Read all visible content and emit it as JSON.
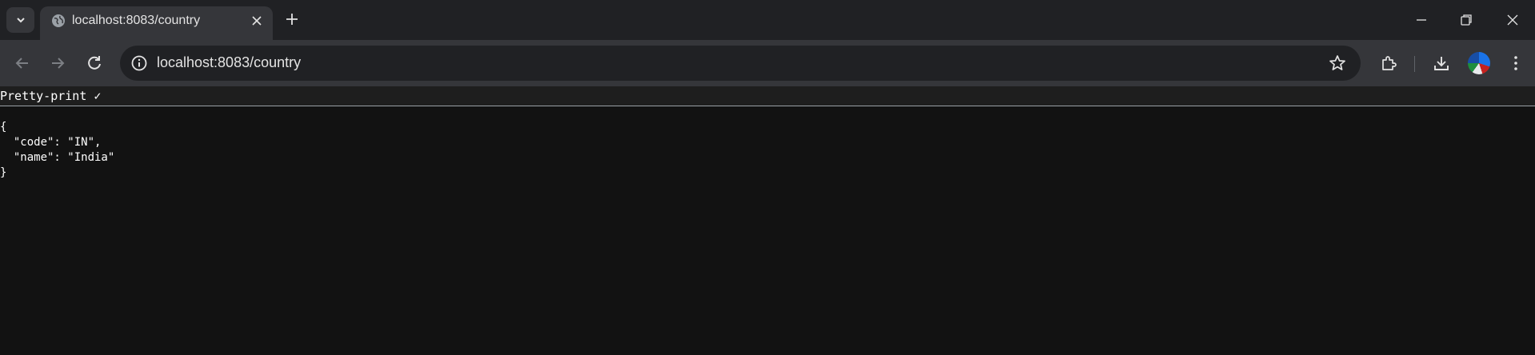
{
  "browser": {
    "tab": {
      "title": "localhost:8083/country",
      "favicon": "globe-icon"
    },
    "address_bar": {
      "url": "localhost:8083/country"
    },
    "icons": {
      "tab_search": "chevron-down-icon",
      "tab_close": "close-icon",
      "new_tab": "plus-icon",
      "minimize": "minimize-icon",
      "restore": "restore-icon",
      "close_window": "close-icon",
      "back": "back-arrow-icon",
      "forward": "forward-arrow-icon",
      "reload": "reload-icon",
      "site_info": "info-icon",
      "bookmark": "star-icon",
      "extensions": "puzzle-icon",
      "downloads": "download-icon",
      "profile": "avatar",
      "menu": "kebab-menu-icon"
    }
  },
  "viewer": {
    "pretty_print_label": "Pretty-print ✓",
    "json_lines": [
      "{",
      "  \"code\": \"IN\",",
      "  \"name\": \"India\"",
      "}"
    ]
  },
  "colors": {
    "tabstrip_bg": "#202124",
    "toolbar_bg": "#35363a",
    "page_bg": "#121212"
  }
}
